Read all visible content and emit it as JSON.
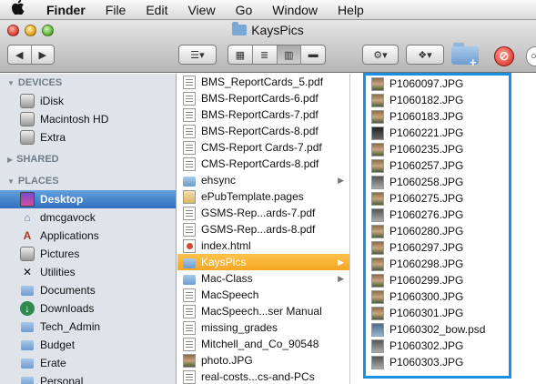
{
  "menubar": {
    "apple": "",
    "items": [
      "Finder",
      "File",
      "Edit",
      "View",
      "Go",
      "Window",
      "Help"
    ]
  },
  "window": {
    "title": "KaysPics"
  },
  "toolbar": {
    "back_glyph": "◀",
    "forward_glyph": "▶",
    "arrange_glyph": "☰▾",
    "view_modes": [
      "▦",
      "≣",
      "▥",
      "▬"
    ],
    "active_view": "columns",
    "action_glyph": "⚙▾",
    "dropbox_glyph": "❖▾",
    "delete_glyph": "⊘",
    "search_glyph": "🔍"
  },
  "sidebar": {
    "devices_header": "DEVICES",
    "devices": [
      {
        "label": "iDisk",
        "icon": "idisk-icon"
      },
      {
        "label": "Macintosh HD",
        "icon": "hard-disk-icon"
      },
      {
        "label": "Extra",
        "icon": "disk-icon"
      }
    ],
    "shared_header": "SHARED",
    "places_header": "PLACES",
    "places": [
      {
        "label": "Desktop",
        "icon": "desktop-icon",
        "selected": true
      },
      {
        "label": "dmcgavock",
        "icon": "home-icon"
      },
      {
        "label": "Applications",
        "icon": "applications-icon"
      },
      {
        "label": "Pictures",
        "icon": "pictures-icon"
      },
      {
        "label": "Utilities",
        "icon": "utilities-icon"
      },
      {
        "label": "Documents",
        "icon": "documents-icon"
      },
      {
        "label": "Downloads",
        "icon": "downloads-icon"
      },
      {
        "label": "Tech_Admin",
        "icon": "folder-icon"
      },
      {
        "label": "Budget",
        "icon": "folder-icon"
      },
      {
        "label": "Erate",
        "icon": "folder-icon"
      },
      {
        "label": "Personal",
        "icon": "folder-icon"
      }
    ]
  },
  "desktop_column": {
    "items": [
      {
        "label": "BMS_ReportCards_5.pdf",
        "kind": "pdf"
      },
      {
        "label": "BMS-ReportCards-6.pdf",
        "kind": "pdf"
      },
      {
        "label": "BMS-ReportCards-7.pdf",
        "kind": "pdf"
      },
      {
        "label": "BMS-ReportCards-8.pdf",
        "kind": "pdf"
      },
      {
        "label": "CMS-Report Cards-7.pdf",
        "kind": "pdf"
      },
      {
        "label": "CMS-ReportCards-8.pdf",
        "kind": "pdf"
      },
      {
        "label": "ehsync",
        "kind": "folder",
        "arrow": "▶"
      },
      {
        "label": "ePubTemplate.pages",
        "kind": "pages"
      },
      {
        "label": "GSMS-Rep...ards-7.pdf",
        "kind": "pdf"
      },
      {
        "label": "GSMS-Rep...ards-8.pdf",
        "kind": "pdf"
      },
      {
        "label": "index.html",
        "kind": "html"
      },
      {
        "label": "KaysPics",
        "kind": "folder",
        "arrow": "▶",
        "selected": true
      },
      {
        "label": "Mac-Class",
        "kind": "folder",
        "arrow": "▶"
      },
      {
        "label": "MacSpeech",
        "kind": "pdf"
      },
      {
        "label": "MacSpeech...ser Manual",
        "kind": "pdf"
      },
      {
        "label": "missing_grades",
        "kind": "pdf"
      },
      {
        "label": "Mitchell_and_Co_90548",
        "kind": "pdf"
      },
      {
        "label": "photo.JPG",
        "kind": "img"
      },
      {
        "label": "real-costs...cs-and-PCs",
        "kind": "pdf"
      }
    ]
  },
  "kayspics_column": {
    "items": [
      {
        "label": "P1060097.JPG",
        "kind": "img"
      },
      {
        "label": "P1060182.JPG",
        "kind": "img"
      },
      {
        "label": "P1060183.JPG",
        "kind": "img"
      },
      {
        "label": "P1060221.JPG",
        "kind": "dark"
      },
      {
        "label": "P1060235.JPG",
        "kind": "img"
      },
      {
        "label": "P1060257.JPG",
        "kind": "img"
      },
      {
        "label": "P1060258.JPG",
        "kind": "gray"
      },
      {
        "label": "P1060275.JPG",
        "kind": "img"
      },
      {
        "label": "P1060276.JPG",
        "kind": "gray"
      },
      {
        "label": "P1060280.JPG",
        "kind": "img"
      },
      {
        "label": "P1060297.JPG",
        "kind": "img"
      },
      {
        "label": "P1060298.JPG",
        "kind": "img"
      },
      {
        "label": "P1060299.JPG",
        "kind": "img"
      },
      {
        "label": "P1060300.JPG",
        "kind": "img"
      },
      {
        "label": "P1060301.JPG",
        "kind": "img"
      },
      {
        "label": "P1060302_bow.psd",
        "kind": "psd"
      },
      {
        "label": "P1060302.JPG",
        "kind": "gray"
      },
      {
        "label": "P1060303.JPG",
        "kind": "gray"
      }
    ]
  },
  "annotation": {
    "highlight_color": "#1a8fe8"
  },
  "colors": {
    "sidebar_bg": "#dee4ea",
    "selection_blue": "#2e6fbe",
    "selection_orange": "#f5a623"
  }
}
